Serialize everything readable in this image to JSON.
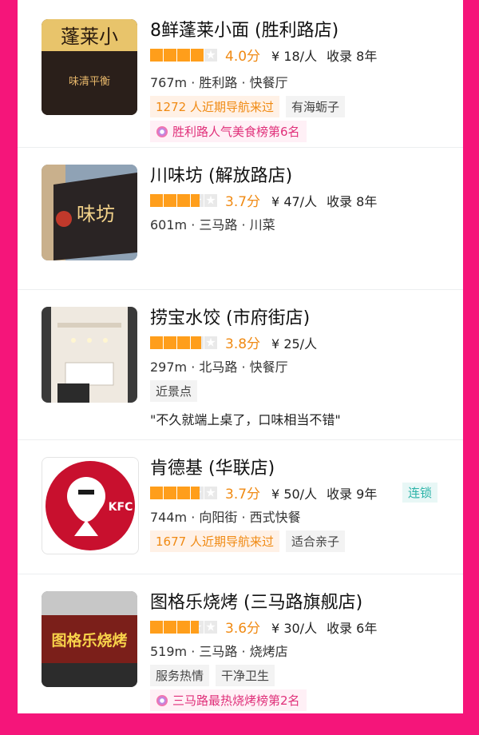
{
  "colors": {
    "background": "#f5157a",
    "score": "#f08a13",
    "star": "#ff9e1b",
    "chain": "#2bb3a8"
  },
  "restaurants": [
    {
      "name": "8鲜蓬莱小面 (胜利路店)",
      "rating": 4.0,
      "score": "4.0分",
      "price": "¥ 18/人",
      "years": "收录 8年",
      "meta": "767m · 胜利路 · 快餐厅",
      "tag1": "1272 人近期导航来过",
      "tag2": "有海蛎子",
      "rank": "胜利路人气美食榜第6名",
      "thumb_text": "蓬莱小",
      "thumb_sub": "味清平衡"
    },
    {
      "name": "川味坊 (解放路店)",
      "rating": 3.7,
      "score": "3.7分",
      "price": "¥ 47/人",
      "years": "收录 8年",
      "meta": "601m · 三马路 · 川菜",
      "thumb_text": "味坊"
    },
    {
      "name": "捞宝水饺 (市府街店)",
      "rating": 3.8,
      "score": "3.8分",
      "price": "¥ 25/人",
      "meta": "297m · 北马路 · 快餐厅",
      "tag1": "近景点",
      "quote": "\"不久就端上桌了，口味相当不错\""
    },
    {
      "name": "肯德基 (华联店)",
      "rating": 3.7,
      "score": "3.7分",
      "price": "¥ 50/人",
      "years": "收录 9年",
      "chain": "连锁",
      "meta": "744m · 向阳街 · 西式快餐",
      "tag1": "1677 人近期导航来过",
      "tag2": "适合亲子",
      "thumb_text": "KFC"
    },
    {
      "name": "图格乐烧烤 (三马路旗舰店)",
      "rating": 3.6,
      "score": "3.6分",
      "price": "¥ 30/人",
      "years": "收录 6年",
      "meta": "519m · 三马路 · 烧烤店",
      "tag1": "服务热情",
      "tag2": "干净卫生",
      "rank": "三马路最热烧烤榜第2名",
      "thumb_text": "图格乐烧烤"
    }
  ]
}
